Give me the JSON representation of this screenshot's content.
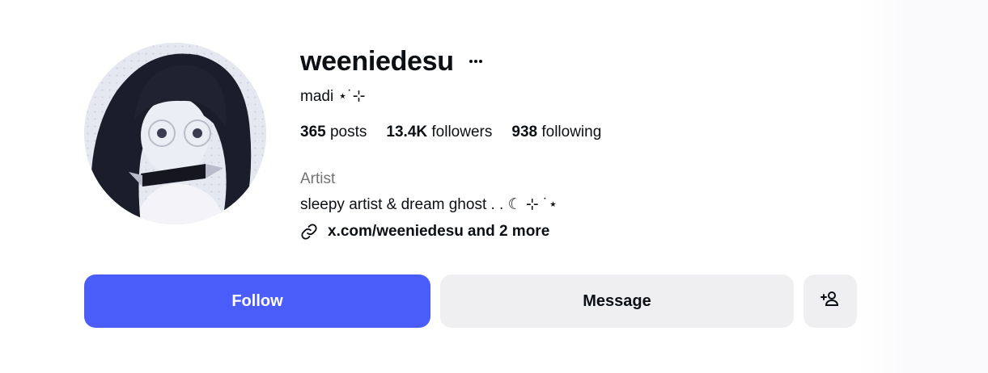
{
  "profile": {
    "username": "weeniedesu",
    "full_name": "madi ⋆˙⊹",
    "category": "Artist",
    "bio": "sleepy artist & dream ghost . . ☾ ⊹ ˙⋆",
    "links_primary": "x.com/weeniedesu",
    "links_more": "and 2 more"
  },
  "stats": {
    "posts_count": "365",
    "posts_label": "posts",
    "followers_count": "13.4K",
    "followers_label": "followers",
    "following_count": "938",
    "following_label": "following"
  },
  "actions": {
    "follow_label": "Follow",
    "message_label": "Message"
  },
  "icons": {
    "more": "more-options-icon",
    "link": "link-icon",
    "add_user": "add-user-icon"
  },
  "colors": {
    "accent": "#4a5df9",
    "secondary_button": "#efeff2",
    "muted_text": "#737373"
  }
}
